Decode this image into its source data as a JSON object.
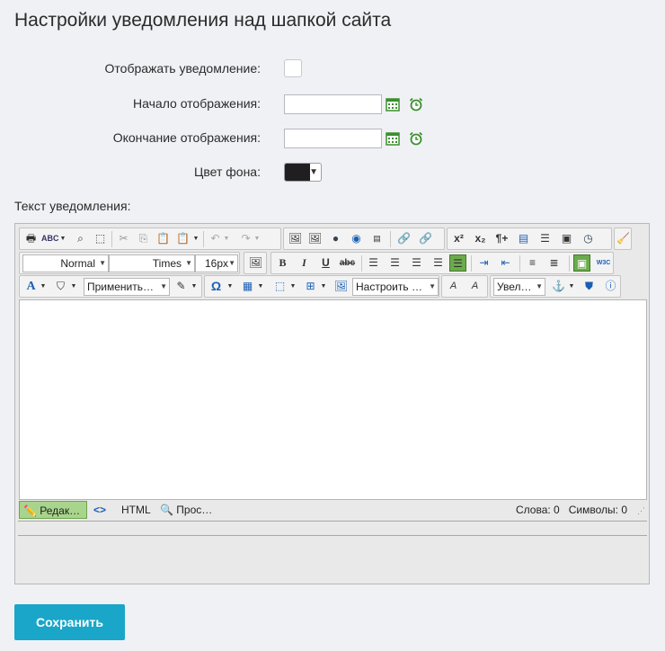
{
  "page": {
    "title": "Настройки уведомления над шапкой сайта"
  },
  "form": {
    "show_label": "Отображать уведомление:",
    "start_label": "Начало отображения:",
    "end_label": "Окончание отображения:",
    "color_label": "Цвет фона:",
    "color_value": "#1f1f22",
    "start_value": "",
    "end_value": ""
  },
  "editor": {
    "label": "Текст уведомления:",
    "toolbar": {
      "format_value": "Normal",
      "font_value": "Times",
      "size_value": "16px",
      "style_value": "Применить…",
      "layout_value": "Настроить …",
      "zoom_value": "Увел…",
      "bold": "B",
      "italic": "I",
      "underline": "U",
      "strike": "abc",
      "omega": "Ω",
      "text_color": "A",
      "w3c": "W3C",
      "superscript": "x²",
      "subscript": "x₂",
      "pilcrow": "¶+"
    },
    "status": {
      "edit_mode": "Редак…",
      "html_mode": "HTML",
      "preview_mode": "Прос…",
      "words_label": "Слова: 0",
      "chars_label": "Символы: 0"
    }
  },
  "actions": {
    "save_label": "Сохранить"
  },
  "colors": {
    "accent": "#19a6c8",
    "active_mode": "#a8d48c",
    "icon_green": "#3b8f2e"
  }
}
